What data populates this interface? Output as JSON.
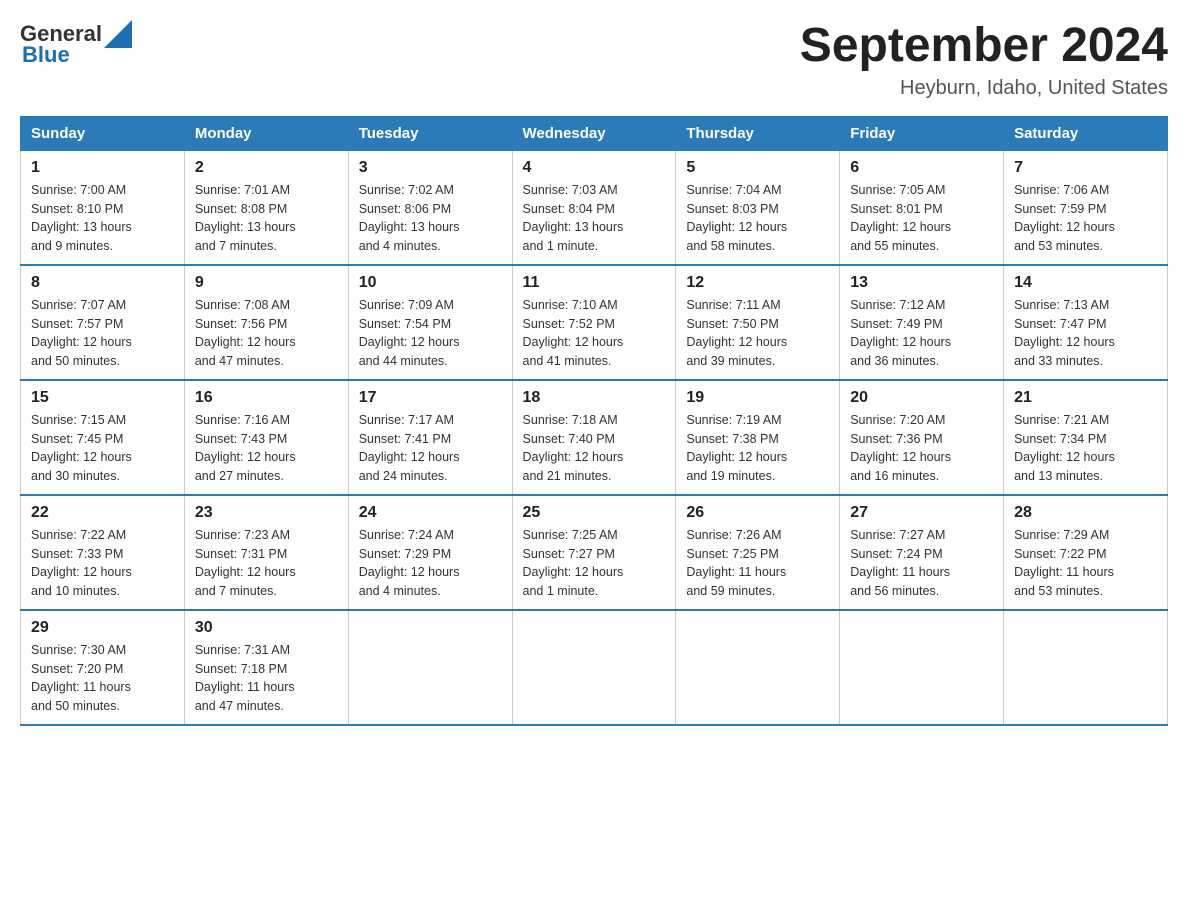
{
  "logo": {
    "text_general": "General",
    "text_blue": "Blue"
  },
  "title": "September 2024",
  "subtitle": "Heyburn, Idaho, United States",
  "weekdays": [
    "Sunday",
    "Monday",
    "Tuesday",
    "Wednesday",
    "Thursday",
    "Friday",
    "Saturday"
  ],
  "weeks": [
    [
      {
        "day": "1",
        "sunrise": "7:00 AM",
        "sunset": "8:10 PM",
        "daylight": "13 hours and 9 minutes."
      },
      {
        "day": "2",
        "sunrise": "7:01 AM",
        "sunset": "8:08 PM",
        "daylight": "13 hours and 7 minutes."
      },
      {
        "day": "3",
        "sunrise": "7:02 AM",
        "sunset": "8:06 PM",
        "daylight": "13 hours and 4 minutes."
      },
      {
        "day": "4",
        "sunrise": "7:03 AM",
        "sunset": "8:04 PM",
        "daylight": "13 hours and 1 minute."
      },
      {
        "day": "5",
        "sunrise": "7:04 AM",
        "sunset": "8:03 PM",
        "daylight": "12 hours and 58 minutes."
      },
      {
        "day": "6",
        "sunrise": "7:05 AM",
        "sunset": "8:01 PM",
        "daylight": "12 hours and 55 minutes."
      },
      {
        "day": "7",
        "sunrise": "7:06 AM",
        "sunset": "7:59 PM",
        "daylight": "12 hours and 53 minutes."
      }
    ],
    [
      {
        "day": "8",
        "sunrise": "7:07 AM",
        "sunset": "7:57 PM",
        "daylight": "12 hours and 50 minutes."
      },
      {
        "day": "9",
        "sunrise": "7:08 AM",
        "sunset": "7:56 PM",
        "daylight": "12 hours and 47 minutes."
      },
      {
        "day": "10",
        "sunrise": "7:09 AM",
        "sunset": "7:54 PM",
        "daylight": "12 hours and 44 minutes."
      },
      {
        "day": "11",
        "sunrise": "7:10 AM",
        "sunset": "7:52 PM",
        "daylight": "12 hours and 41 minutes."
      },
      {
        "day": "12",
        "sunrise": "7:11 AM",
        "sunset": "7:50 PM",
        "daylight": "12 hours and 39 minutes."
      },
      {
        "day": "13",
        "sunrise": "7:12 AM",
        "sunset": "7:49 PM",
        "daylight": "12 hours and 36 minutes."
      },
      {
        "day": "14",
        "sunrise": "7:13 AM",
        "sunset": "7:47 PM",
        "daylight": "12 hours and 33 minutes."
      }
    ],
    [
      {
        "day": "15",
        "sunrise": "7:15 AM",
        "sunset": "7:45 PM",
        "daylight": "12 hours and 30 minutes."
      },
      {
        "day": "16",
        "sunrise": "7:16 AM",
        "sunset": "7:43 PM",
        "daylight": "12 hours and 27 minutes."
      },
      {
        "day": "17",
        "sunrise": "7:17 AM",
        "sunset": "7:41 PM",
        "daylight": "12 hours and 24 minutes."
      },
      {
        "day": "18",
        "sunrise": "7:18 AM",
        "sunset": "7:40 PM",
        "daylight": "12 hours and 21 minutes."
      },
      {
        "day": "19",
        "sunrise": "7:19 AM",
        "sunset": "7:38 PM",
        "daylight": "12 hours and 19 minutes."
      },
      {
        "day": "20",
        "sunrise": "7:20 AM",
        "sunset": "7:36 PM",
        "daylight": "12 hours and 16 minutes."
      },
      {
        "day": "21",
        "sunrise": "7:21 AM",
        "sunset": "7:34 PM",
        "daylight": "12 hours and 13 minutes."
      }
    ],
    [
      {
        "day": "22",
        "sunrise": "7:22 AM",
        "sunset": "7:33 PM",
        "daylight": "12 hours and 10 minutes."
      },
      {
        "day": "23",
        "sunrise": "7:23 AM",
        "sunset": "7:31 PM",
        "daylight": "12 hours and 7 minutes."
      },
      {
        "day": "24",
        "sunrise": "7:24 AM",
        "sunset": "7:29 PM",
        "daylight": "12 hours and 4 minutes."
      },
      {
        "day": "25",
        "sunrise": "7:25 AM",
        "sunset": "7:27 PM",
        "daylight": "12 hours and 1 minute."
      },
      {
        "day": "26",
        "sunrise": "7:26 AM",
        "sunset": "7:25 PM",
        "daylight": "11 hours and 59 minutes."
      },
      {
        "day": "27",
        "sunrise": "7:27 AM",
        "sunset": "7:24 PM",
        "daylight": "11 hours and 56 minutes."
      },
      {
        "day": "28",
        "sunrise": "7:29 AM",
        "sunset": "7:22 PM",
        "daylight": "11 hours and 53 minutes."
      }
    ],
    [
      {
        "day": "29",
        "sunrise": "7:30 AM",
        "sunset": "7:20 PM",
        "daylight": "11 hours and 50 minutes."
      },
      {
        "day": "30",
        "sunrise": "7:31 AM",
        "sunset": "7:18 PM",
        "daylight": "11 hours and 47 minutes."
      },
      null,
      null,
      null,
      null,
      null
    ]
  ],
  "labels": {
    "sunrise": "Sunrise:",
    "sunset": "Sunset:",
    "daylight": "Daylight:"
  }
}
